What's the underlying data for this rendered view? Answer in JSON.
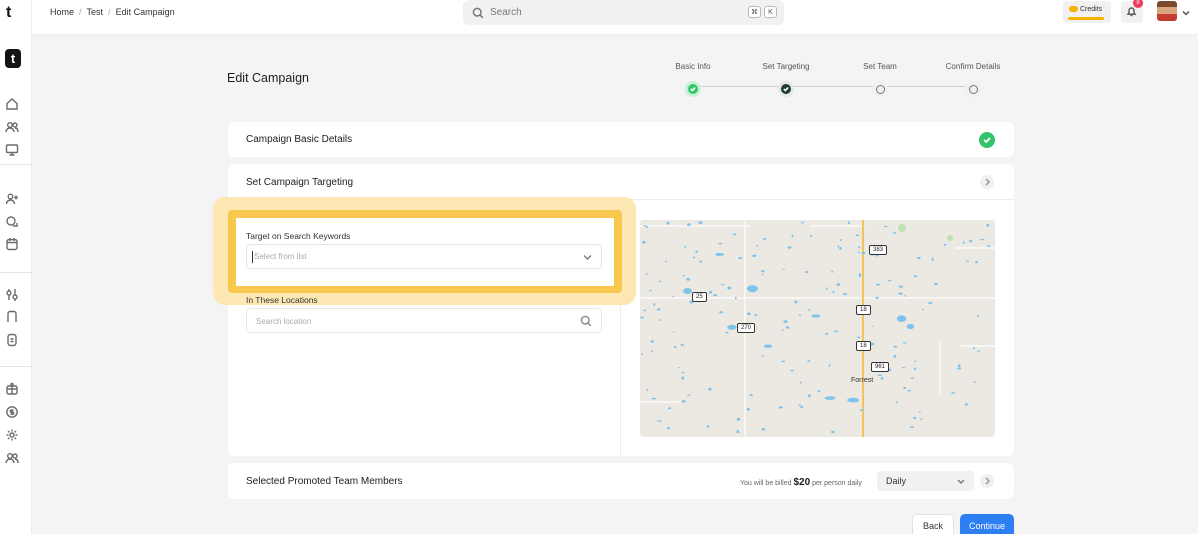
{
  "topbar": {
    "breadcrumbs": [
      "Home",
      "Test",
      "Edit Campaign"
    ],
    "search_placeholder": "Search",
    "shortcut_keys": [
      "⌘",
      "K"
    ],
    "credits_label": "Credits",
    "notification_count": "8"
  },
  "rail": {
    "top_letter": "t",
    "logo_letter": "t"
  },
  "page": {
    "title": "Edit Campaign"
  },
  "stepper": {
    "steps": [
      {
        "label": "Basic Info",
        "state": "done"
      },
      {
        "label": "Set Targeting",
        "state": "active"
      },
      {
        "label": "Set Team",
        "state": "todo"
      },
      {
        "label": "Confirm Details",
        "state": "todo"
      }
    ]
  },
  "sections": {
    "basic_details": "Campaign Basic Details",
    "targeting": "Set Campaign Targeting",
    "promoted": "Selected Promoted Team Members"
  },
  "targeting": {
    "keywords_label": "Target on Search Keywords",
    "keywords_placeholder": "Select from list",
    "locations_label": "In These Locations",
    "locations_placeholder": "Search location"
  },
  "map": {
    "road_labels": [
      "383",
      "25",
      "270",
      "18",
      "18",
      "961"
    ],
    "place_label": "Forrest"
  },
  "promoted": {
    "billing_prefix": "You will be billed",
    "billing_amount": "$20",
    "billing_suffix": "per person daily",
    "frequency": "Daily"
  },
  "actions": {
    "back": "Back",
    "continue": "Continue"
  },
  "colors": {
    "accent": "#2f7ff4",
    "success": "#34c46b",
    "highlight": "#f8c84e"
  }
}
